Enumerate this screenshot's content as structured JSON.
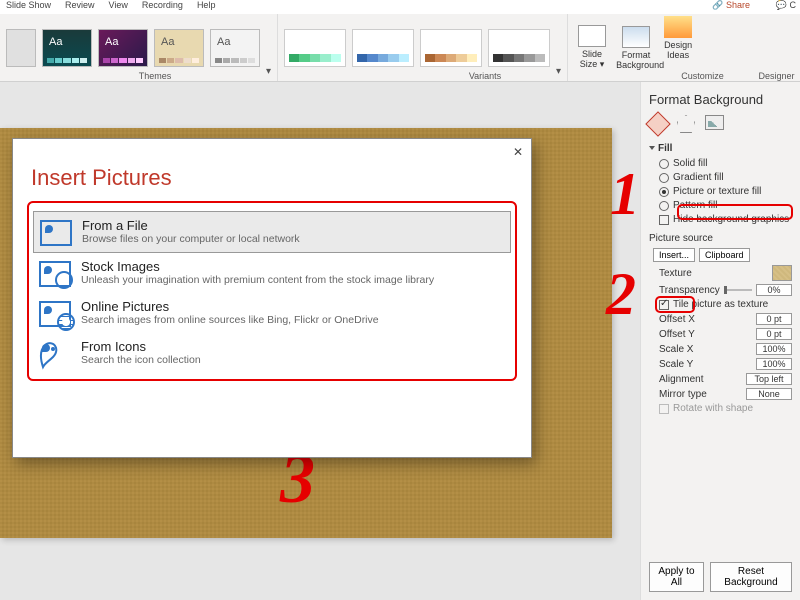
{
  "ribbon_tabs": [
    "Slide Show",
    "Review",
    "View",
    "Recording",
    "Help"
  ],
  "share": "Share",
  "comments": "C",
  "themes_label": "Themes",
  "variants_label": "Variants",
  "customize_label": "Customize",
  "designer_label": "Designer",
  "slide_size": {
    "line1": "Slide",
    "line2": "Size"
  },
  "format_bg_btn": {
    "line1": "Format",
    "line2": "Background"
  },
  "design_ideas": {
    "line1": "Design",
    "line2": "Ideas"
  },
  "theme_label": "Aa",
  "pane": {
    "title": "Format Background",
    "fill_section": "Fill",
    "solid": "Solid fill",
    "gradient": "Gradient fill",
    "picture": "Picture or texture fill",
    "pattern": "Pattern fill",
    "hide": "Hide background graphics",
    "picture_source": "Picture source",
    "insert_btn": "Insert...",
    "clipboard_btn": "Clipboard",
    "texture": "Texture",
    "transparency": "Transparency",
    "transparency_val": "0%",
    "tile": "Tile picture as texture",
    "offset_x": "Offset X",
    "offset_x_val": "0 pt",
    "offset_y": "Offset Y",
    "offset_y_val": "0 pt",
    "scale_x": "Scale X",
    "scale_x_val": "100%",
    "scale_y": "Scale Y",
    "scale_y_val": "100%",
    "alignment": "Alignment",
    "alignment_val": "Top left",
    "mirror": "Mirror type",
    "mirror_val": "None",
    "rotate": "Rotate with shape",
    "apply_all": "Apply to All",
    "reset": "Reset Background"
  },
  "dialog": {
    "title": "Insert Pictures",
    "close": "✕",
    "options": [
      {
        "title": "From a File",
        "desc": "Browse files on your computer or local network"
      },
      {
        "title": "Stock Images",
        "desc": "Unleash your imagination with premium content from the stock image library"
      },
      {
        "title": "Online Pictures",
        "desc": "Search images from online sources like Bing, Flickr or OneDrive"
      },
      {
        "title": "From Icons",
        "desc": "Search the icon collection"
      }
    ]
  },
  "anno": {
    "n1": "1",
    "n2": "2",
    "n3": "3"
  }
}
